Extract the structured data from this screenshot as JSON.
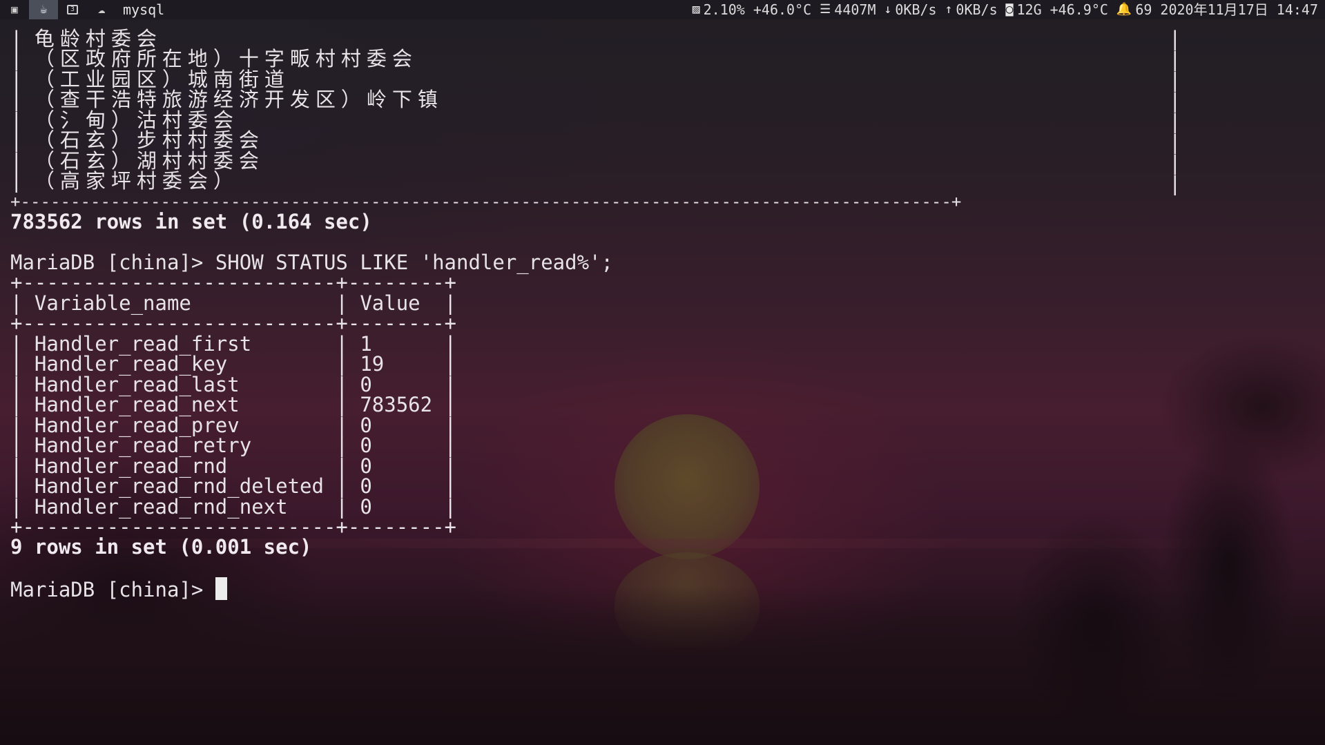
{
  "topbar": {
    "workspaces": [
      {
        "icon": "terminal-icon",
        "active": false
      },
      {
        "icon": "coffee-icon",
        "active": true
      },
      {
        "icon": "number-three-icon",
        "label": "3",
        "active": false
      },
      {
        "icon": "cloud-icon",
        "active": false
      }
    ],
    "window_title": "mysql",
    "status": {
      "cpu": "2.10%",
      "cpu_temp": "+46.0°C",
      "memory": "4407M",
      "net_down": "0KB/s",
      "net_up": "0KB/s",
      "disk": "12G",
      "disk_temp": "+46.9°C",
      "notifications": "69",
      "datetime": "2020年11月17日 14:47"
    }
  },
  "terminal": {
    "prev_rows": [
      "龟龄村委会",
      "（区政府所在地）十字畈村村委会",
      "（工业园区）城南街道",
      "（查干浩特旅游经济开发区）岭下镇",
      "（氵甸）沽村委会",
      "（石玄）步村村委会",
      "（石玄）湖村村委会",
      "（高家坪村委会）"
    ],
    "prev_border": "+---------------------------------------------------------------------------------------------+",
    "prev_summary": "783562 rows in set (0.164 sec)",
    "prompt": "MariaDB [china]> ",
    "command": "SHOW STATUS LIKE 'handler_read%';",
    "table_border": "+--------------------------+--------+",
    "header_line": "| Variable_name            | Value  |",
    "rows": [
      "| Handler_read_first       | 1      |",
      "| Handler_read_key         | 19     |",
      "| Handler_read_last        | 0      |",
      "| Handler_read_next        | 783562 |",
      "| Handler_read_prev        | 0      |",
      "| Handler_read_retry       | 0      |",
      "| Handler_read_rnd         | 0      |",
      "| Handler_read_rnd_deleted | 0      |",
      "| Handler_read_rnd_next    | 0      |"
    ],
    "summary": "9 rows in set (0.001 sec)",
    "final_prompt": "MariaDB [china]> "
  }
}
